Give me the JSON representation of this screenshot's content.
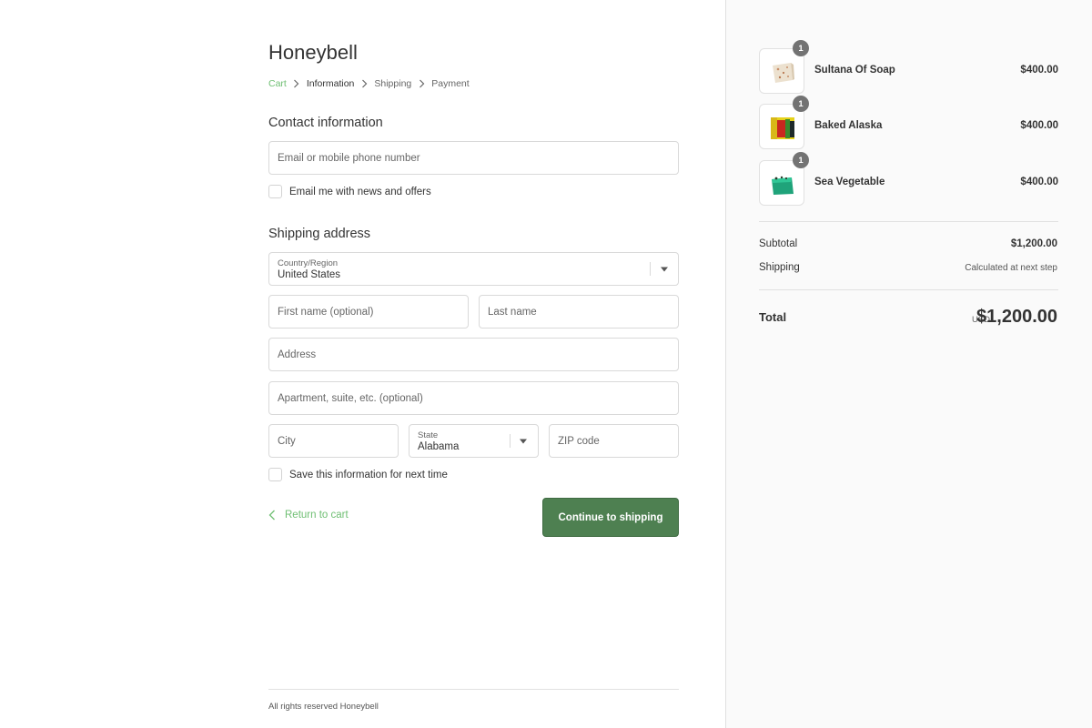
{
  "store": {
    "name": "Honeybell"
  },
  "breadcrumb": [
    {
      "label": "Cart",
      "state": "link"
    },
    {
      "label": "Information",
      "state": "current"
    },
    {
      "label": "Shipping",
      "state": "next"
    },
    {
      "label": "Payment",
      "state": "next"
    }
  ],
  "contact": {
    "title": "Contact information",
    "email_placeholder": "Email or mobile phone number",
    "newsletter_label": "Email me with news and offers",
    "newsletter_checked": false
  },
  "shipping": {
    "title": "Shipping address",
    "country_label": "Country/Region",
    "country_value": "United States",
    "first_name_placeholder": "First name (optional)",
    "last_name_placeholder": "Last name",
    "address_placeholder": "Address",
    "apartment_placeholder": "Apartment, suite, etc. (optional)",
    "city_placeholder": "City",
    "state_label": "State",
    "state_value": "Alabama",
    "zip_placeholder": "ZIP code",
    "save_info_label": "Save this information for next time",
    "save_info_checked": false
  },
  "actions": {
    "return_label": "Return to cart",
    "continue_label": "Continue to shipping"
  },
  "footer": {
    "text": "All rights reserved Honeybell"
  },
  "order": {
    "items": [
      {
        "name": "Sultana Of Soap",
        "price": "$400.00",
        "qty": "1"
      },
      {
        "name": "Baked Alaska",
        "price": "$400.00",
        "qty": "1"
      },
      {
        "name": "Sea Vegetable",
        "price": "$400.00",
        "qty": "1"
      }
    ],
    "subtotal_label": "Subtotal",
    "subtotal_value": "$1,200.00",
    "shipping_label": "Shipping",
    "shipping_value": "Calculated at next step",
    "total_label": "Total",
    "total_currency": "USD",
    "total_value": "$1,200.00"
  },
  "colors": {
    "accent": "#6fbf73",
    "button": "#4e8051",
    "sidebar_bg": "#fafafa"
  }
}
